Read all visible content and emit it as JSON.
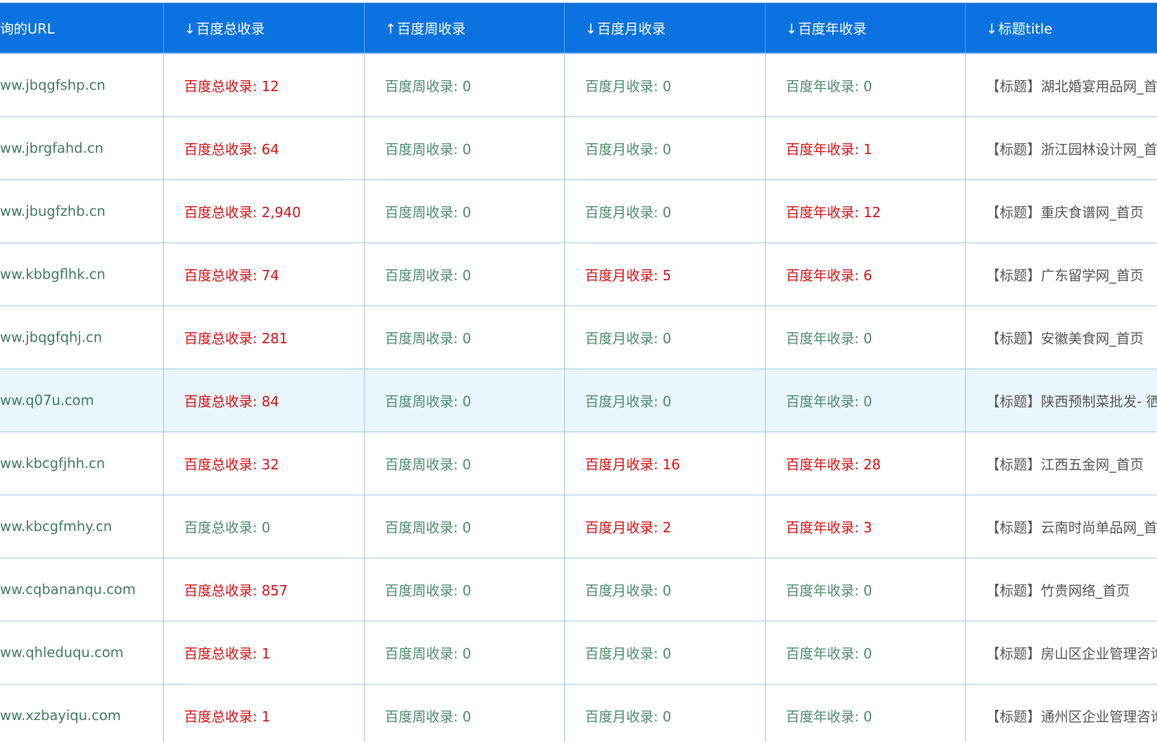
{
  "colors": {
    "header_bg": "#0a73e0",
    "header_text": "#ffffff",
    "zero_value": "#4d8a6a",
    "nonzero_value": "#d40f12",
    "row_highlight": "#eaf6fd",
    "grid_line": "#9ec6e6"
  },
  "header": {
    "url": "询的URL",
    "total": {
      "arrow": "↓",
      "label": "百度总收录"
    },
    "week": {
      "arrow": "↑",
      "label": "百度周收录"
    },
    "month": {
      "arrow": "↓",
      "label": "百度月收录"
    },
    "year": {
      "arrow": "↓",
      "label": "百度年收录"
    },
    "title": {
      "arrow": "↓",
      "label": "标题title"
    }
  },
  "rows": [
    {
      "url": "ww.jbqgfshp.cn",
      "total": "百度总收录: 12",
      "week": "百度周收录: 0",
      "month": "百度月收录: 0",
      "year": "百度年收录: 0",
      "title": "【标题】湖北婚宴用品网_首"
    },
    {
      "url": "ww.jbrgfahd.cn",
      "total": "百度总收录: 64",
      "week": "百度周收录: 0",
      "month": "百度月收录: 0",
      "year": "百度年收录: 1",
      "title": "【标题】浙江园林设计网_首"
    },
    {
      "url": "ww.jbugfzhb.cn",
      "total": "百度总收录: 2,940",
      "week": "百度周收录: 0",
      "month": "百度月收录: 0",
      "year": "百度年收录: 12",
      "title": "【标题】重庆食谱网_首页"
    },
    {
      "url": "ww.kbbgflhk.cn",
      "total": "百度总收录: 74",
      "week": "百度周收录: 0",
      "month": "百度月收录: 5",
      "year": "百度年收录: 6",
      "title": "【标题】广东留学网_首页"
    },
    {
      "url": "ww.jbqgfqhj.cn",
      "total": "百度总收录: 281",
      "week": "百度周收录: 0",
      "month": "百度月收录: 0",
      "year": "百度年收录: 0",
      "title": "【标题】安徽美食网_首页"
    },
    {
      "url": "ww.q07u.com",
      "total": "百度总收录: 84",
      "week": "百度周收录: 0",
      "month": "百度月收录: 0",
      "year": "百度年收录: 0",
      "title": "【标题】陕西预制菜批发- 徆",
      "highlight": true
    },
    {
      "url": "ww.kbcgfjhh.cn",
      "total": "百度总收录: 32",
      "week": "百度周收录: 0",
      "month": "百度月收录: 16",
      "year": "百度年收录: 28",
      "title": "【标题】江西五金网_首页"
    },
    {
      "url": "ww.kbcgfmhy.cn",
      "total": "百度总收录: 0",
      "week": "百度周收录: 0",
      "month": "百度月收录: 2",
      "year": "百度年收录: 3",
      "title": "【标题】云南时尚单品网_首"
    },
    {
      "url": "ww.cqbananqu.com",
      "total": "百度总收录: 857",
      "week": "百度周收录: 0",
      "month": "百度月收录: 0",
      "year": "百度年收录: 0",
      "title": "【标题】竹贵网络_首页"
    },
    {
      "url": "ww.qhleduqu.com",
      "total": "百度总收录: 1",
      "week": "百度周收录: 0",
      "month": "百度月收录: 0",
      "year": "百度年收录: 0",
      "title": "【标题】房山区企业管理咨询"
    },
    {
      "url": "ww.xzbayiqu.com",
      "total": "百度总收录: 1",
      "week": "百度周收录: 0",
      "month": "百度月收录: 0",
      "year": "百度年收录: 0",
      "title": "【标题】通州区企业管理咨询"
    }
  ]
}
